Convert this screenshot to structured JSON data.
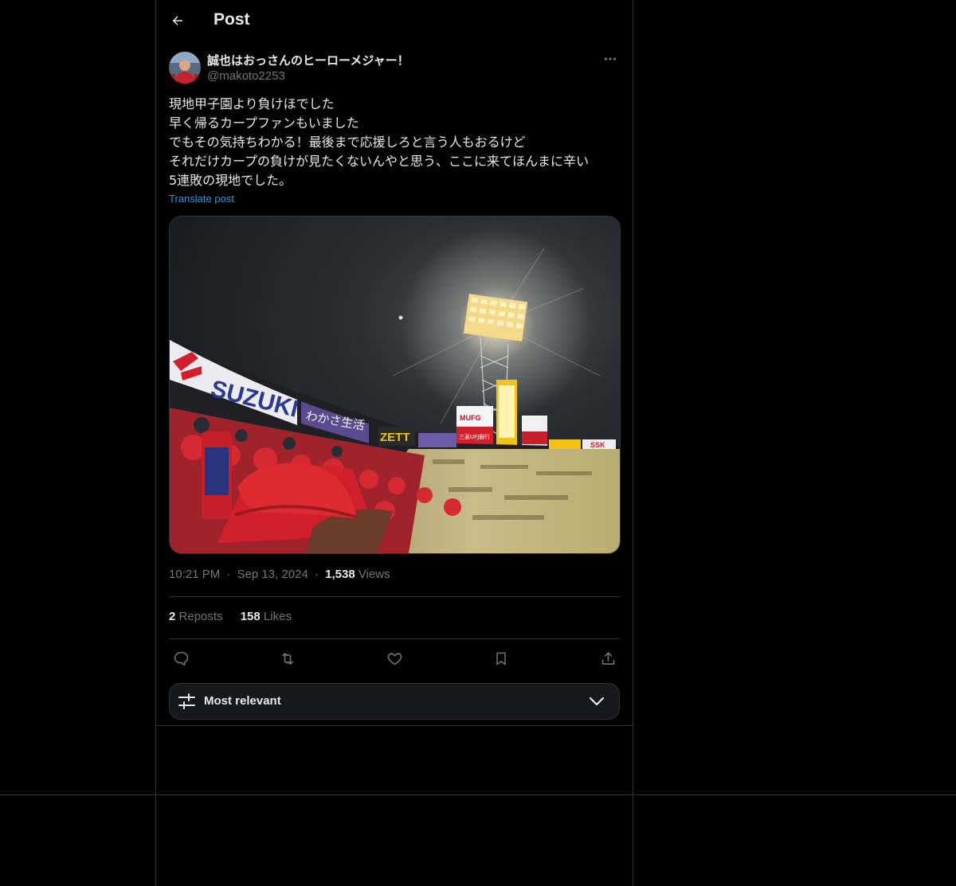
{
  "header": {
    "title": "Post"
  },
  "author": {
    "display_name": "誠也はおっさんのヒーローメジャー！",
    "handle": "@makoto2253"
  },
  "post": {
    "lines": [
      "現地甲子園より負けほでした",
      "早く帰るカープファンもいました",
      "でもその気持ちわかる！最後まで応援しろと言う人もおるけど",
      "それだけカープの負けが見たくないんやと思う、ここに来てほんまに辛い",
      "5連敗の現地でした。"
    ],
    "translate_label": "Translate post"
  },
  "media": {
    "signs": [
      "SUZUKI",
      "わかさ生活",
      "ZETT",
      "MUFG",
      "三菱UFJ銀行",
      "SSK"
    ]
  },
  "meta": {
    "time": "10:21 PM",
    "date": "Sep 13, 2024",
    "views_count": "1,538",
    "views_label": "Views",
    "separator": "·"
  },
  "stats": {
    "reposts_count": "2",
    "reposts_label": "Reposts",
    "likes_count": "158",
    "likes_label": "Likes"
  },
  "actions": [
    "reply-icon",
    "repost-icon",
    "like-icon",
    "bookmark-icon",
    "share-icon"
  ],
  "sort": {
    "label": "Most relevant"
  },
  "colors": {
    "background": "#000000",
    "text": "#e7e9ea",
    "secondary": "#71767b",
    "link": "#1d9bf0",
    "border": "#2f3336"
  }
}
